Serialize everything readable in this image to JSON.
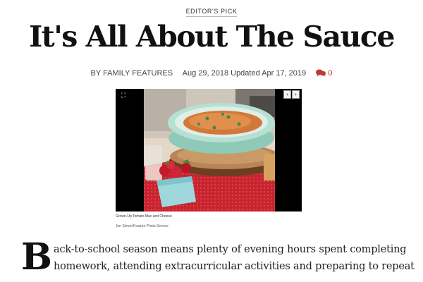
{
  "article": {
    "kicker": "EDITOR'S PICK",
    "headline": "It's All About The Sauce",
    "byline": {
      "author": "BY FAMILY FEATURES",
      "published": "Aug 29, 2018",
      "updated": "Updated Apr 17, 2019",
      "comment_count": "0",
      "comment_icon": "comment-bubbles-icon"
    },
    "media": {
      "fullscreen_icon": "fullscreen-icon",
      "prev_symbol": "‹",
      "next_symbol": "›",
      "caption": "Grown-Up Tomato Mac and Cheese",
      "credit": "Jon Simon/Feature Photo Service"
    },
    "body": {
      "dropcap": "B",
      "lines": [
        "ack-to-school season means plenty of evening hours spent completing",
        "homework, attending extracurricular activities and preparing to repeat"
      ]
    }
  },
  "colors": {
    "accent_red": "#c0392b",
    "text": "#222222",
    "media_bg": "#000000"
  }
}
